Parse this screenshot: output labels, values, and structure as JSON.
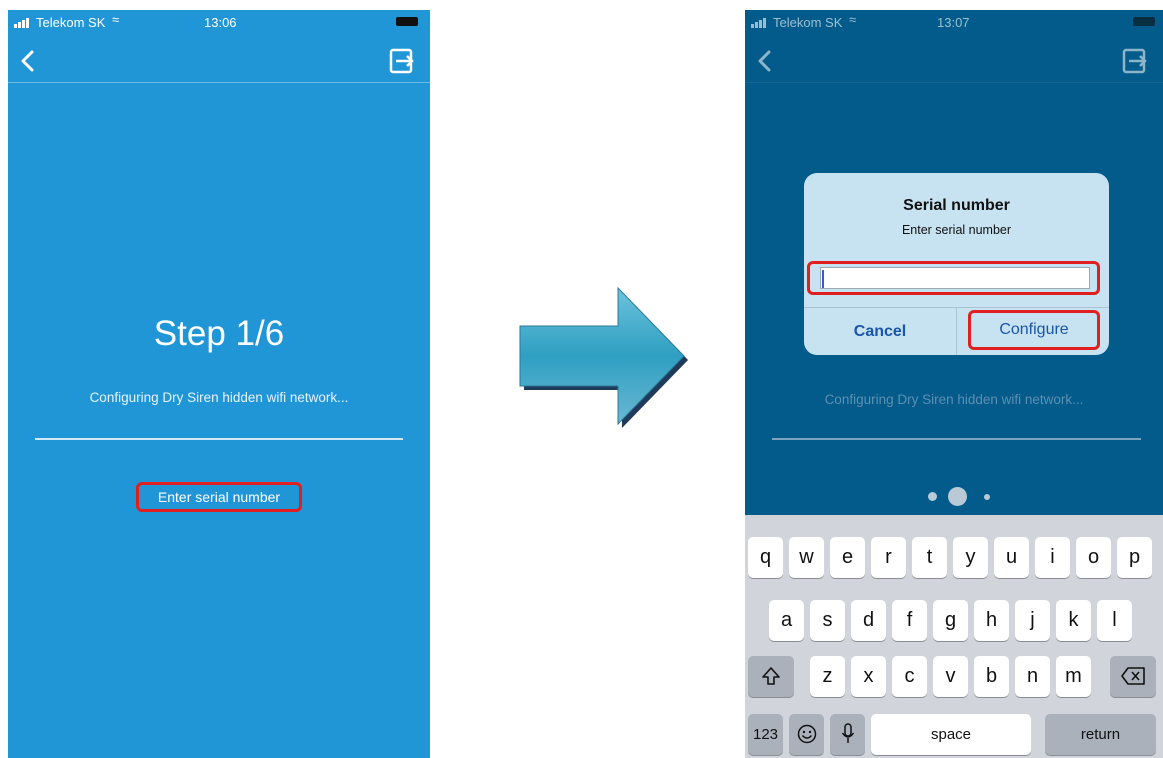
{
  "screen1": {
    "status": {
      "carrier": "Telekom SK",
      "time": "13:06"
    },
    "step_title": "Step 1/6",
    "config_text": "Configuring Dry Siren hidden wifi network...",
    "serial_link": "Enter serial number"
  },
  "screen2": {
    "status": {
      "carrier": "Telekom SK",
      "time": "13:07"
    },
    "config_text": "Configuring Dry Siren hidden wifi network...",
    "dialog": {
      "title": "Serial number",
      "message": "Enter serial number",
      "input_value": "",
      "cancel": "Cancel",
      "configure": "Configure"
    },
    "keyboard": {
      "row1": [
        "q",
        "w",
        "e",
        "r",
        "t",
        "y",
        "u",
        "i",
        "o",
        "p"
      ],
      "row2": [
        "a",
        "s",
        "d",
        "f",
        "g",
        "h",
        "j",
        "k",
        "l"
      ],
      "row3": [
        "z",
        "x",
        "c",
        "v",
        "b",
        "n",
        "m"
      ],
      "numbers": "123",
      "space": "space",
      "return": "return",
      "icons": [
        "shift-icon",
        "backspace-icon",
        "emoji-icon",
        "microphone-icon"
      ]
    }
  },
  "colors": {
    "screen1_bg": "#2196d6",
    "screen2_bg": "#025b8a",
    "highlight": "#e02020",
    "arrow": "#3aa6c6"
  }
}
